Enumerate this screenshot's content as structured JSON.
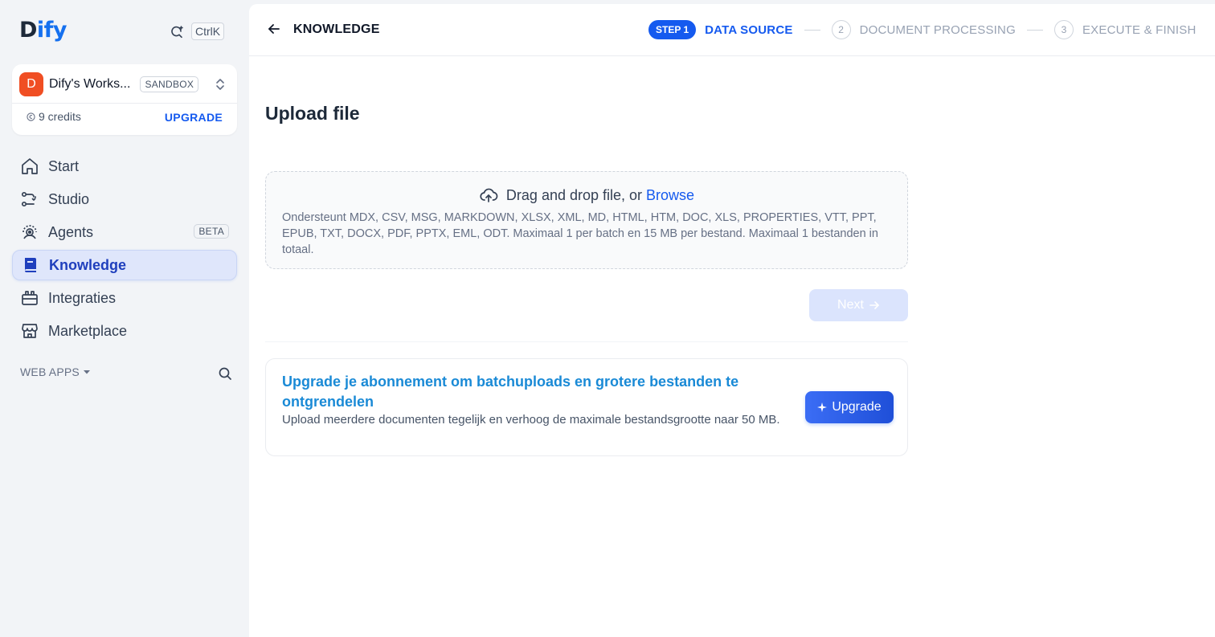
{
  "app": {
    "logo_a": "D",
    "logo_b": "ify",
    "shortcut": "CtrlK"
  },
  "workspace": {
    "avatar": "D",
    "name": "Dify's Works...",
    "badge": "SANDBOX",
    "credits": "9 credits",
    "upgrade": "UPGRADE"
  },
  "nav": {
    "items": [
      {
        "label": "Start",
        "icon": "home-icon"
      },
      {
        "label": "Studio",
        "icon": "studio-icon"
      },
      {
        "label": "Agents",
        "icon": "agents-icon",
        "badge": "BETA"
      },
      {
        "label": "Knowledge",
        "icon": "knowledge-icon",
        "active": true
      },
      {
        "label": "Integraties",
        "icon": "integrations-icon"
      },
      {
        "label": "Marketplace",
        "icon": "marketplace-icon"
      }
    ]
  },
  "webapps": {
    "label": "WEB APPS"
  },
  "header": {
    "title": "KNOWLEDGE",
    "steps": [
      {
        "pill": "STEP 1",
        "label": "DATA SOURCE",
        "state": "active"
      },
      {
        "num": "2",
        "label": "DOCUMENT PROCESSING",
        "state": "inactive"
      },
      {
        "num": "3",
        "label": "EXECUTE & FINISH",
        "state": "inactive"
      }
    ]
  },
  "upload": {
    "title": "Upload file",
    "drop_text": "Drag and drop file, or",
    "browse": "Browse",
    "hint": "Ondersteunt MDX, CSV, MSG, MARKDOWN, XLSX, XML, MD, HTML, HTM, DOC, XLS, PROPERTIES, VTT, PPT, EPUB, TXT, DOCX, PDF, PPTX, EML, ODT. Maximaal 1 per batch en 15 MB per bestand. Maximaal 1 bestanden in totaal.",
    "next": "Next"
  },
  "upgrade_card": {
    "title": "Upgrade je abonnement om batchuploads en grotere bestanden te ontgrendelen",
    "desc": "Upload meerdere documenten tegelijk en verhoog de maximale bestandsgrootte naar 50 MB.",
    "button": "Upgrade"
  },
  "colors": {
    "accent": "#155aef",
    "workspace_avatar": "#f04e23",
    "upgrade_title": "#1a8ad6"
  }
}
